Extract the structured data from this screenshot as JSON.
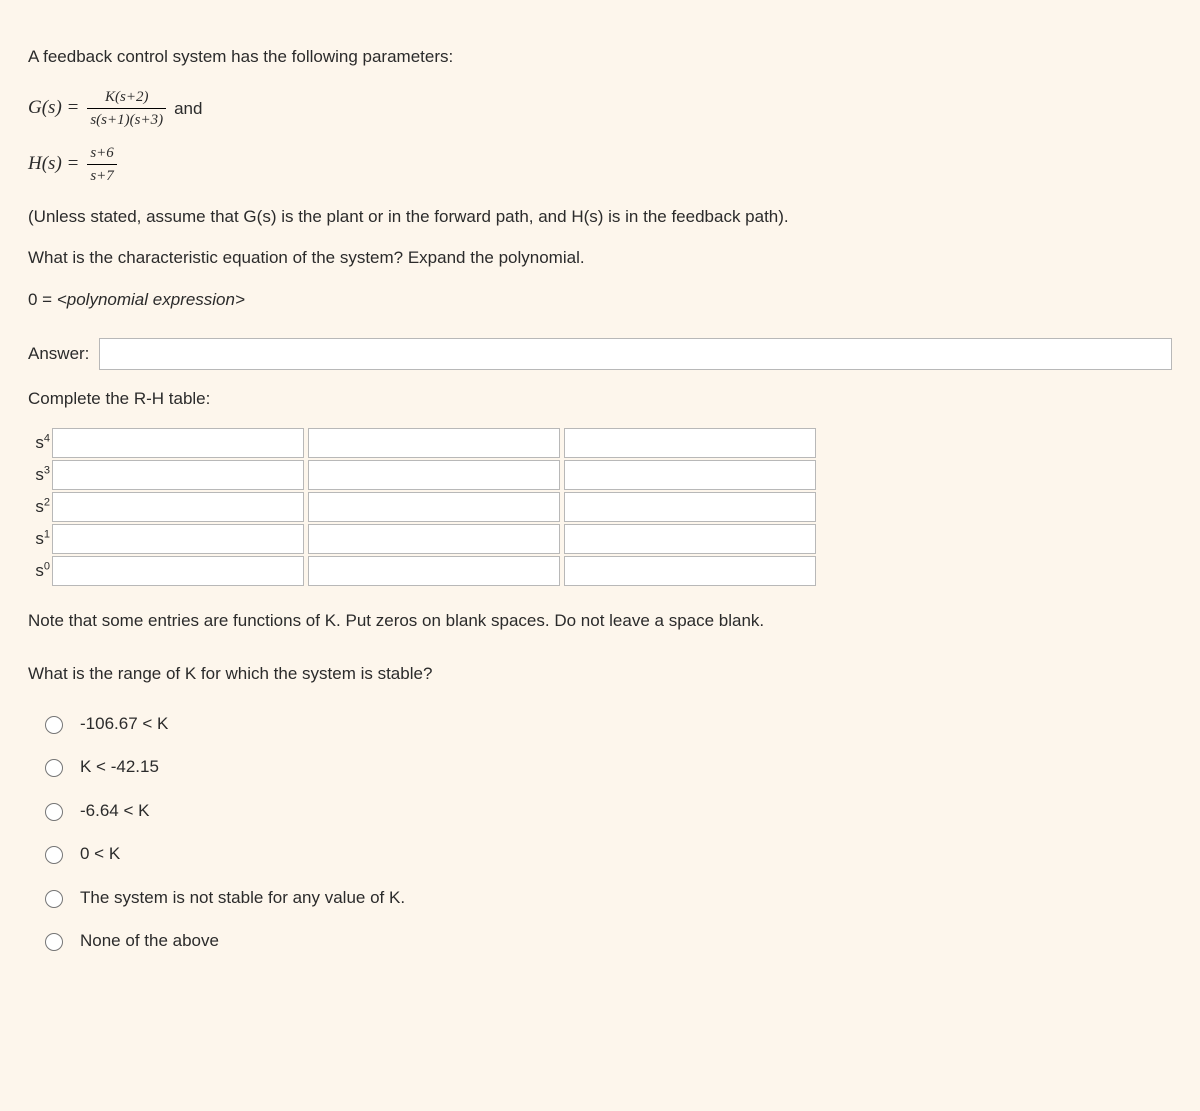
{
  "intro": "A feedback control system has the following parameters:",
  "eq1": {
    "lhs": "G(s) =",
    "num": "K(s+2)",
    "den": "s(s+1)(s+3)",
    "tail": "and"
  },
  "eq2": {
    "lhs": "H(s) =",
    "num": "s+6",
    "den": "s+7"
  },
  "note1": "(Unless stated, assume that G(s) is the plant or in the forward path, and H(s) is in the feedback path).",
  "question1": "What is the characteristic equation of the system? Expand the polynomial.",
  "eq_form": "0 = <polynomial expression>",
  "answer_label": "Answer:",
  "answer_value": "",
  "rh_title": "Complete the R-H table:",
  "rh_rows": [
    {
      "label": "s",
      "sup": "4"
    },
    {
      "label": "s",
      "sup": "3"
    },
    {
      "label": "s",
      "sup": "2"
    },
    {
      "label": "s",
      "sup": "1"
    },
    {
      "label": "s",
      "sup": "0"
    }
  ],
  "rh_note": "Note that some entries are functions of K.  Put zeros on blank spaces. Do not leave a space blank.",
  "question2": "What is the range of K for which the system is stable?",
  "options": [
    "-106.67 < K",
    "K < -42.15",
    "-6.64 < K",
    "0 < K",
    "The system is not stable for any value of K.",
    "None of the above"
  ]
}
